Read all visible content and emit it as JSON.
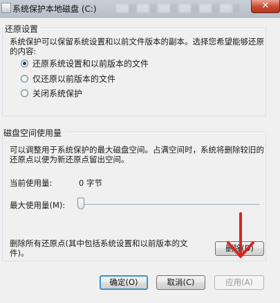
{
  "window": {
    "title": "系统保护本地磁盘 (C:)",
    "close_glyph": "✕"
  },
  "restore": {
    "heading": "还原设置",
    "description": "系统保护可以保留系统设置和以前文件版本的副本。选择您希望能够还原的内容:",
    "options": [
      {
        "label": "还原系统设置和以前版本的文件",
        "selected": true
      },
      {
        "label": "仅还原以前版本的文件",
        "selected": false
      },
      {
        "label": "关闭系统保护",
        "selected": false
      }
    ]
  },
  "disk": {
    "heading": "磁盘空间使用量",
    "description": "可以调整用于系统保护的最大磁盘空间。占满空间时，系统将删除较旧的还原点以便为新还原点留出空间。",
    "current_label": "当前使用量:",
    "current_value": "0 字节",
    "max_label": "最大使用量(M):",
    "max_level_fraction": 0.0,
    "delete_text": "删除所有还原点(其中包括系统设置和以前版本的文件)。",
    "delete_button": "删除(D)"
  },
  "footer": {
    "ok": "确定(O)",
    "cancel": "取消(C)",
    "apply": "应用(A)"
  },
  "annotation": {
    "arrow_color": "#d9261c"
  }
}
